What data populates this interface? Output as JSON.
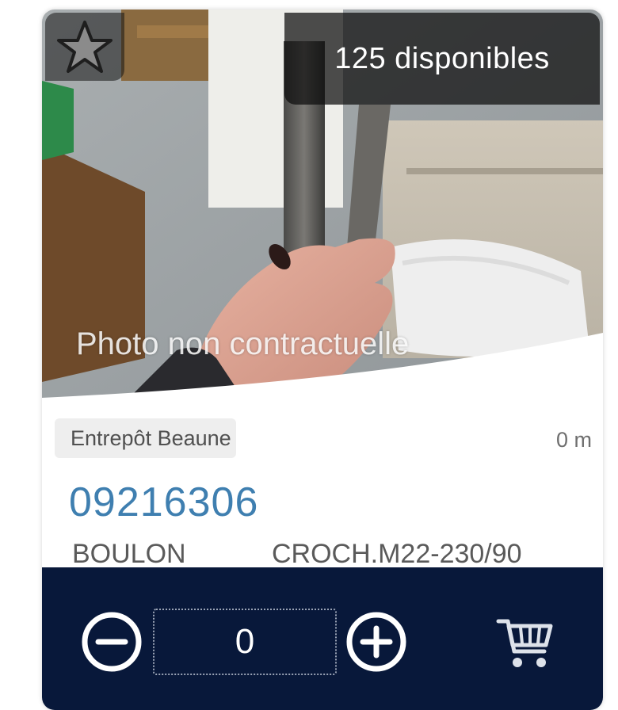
{
  "product_card": {
    "stock_badge": "125 disponibles",
    "photo_disclaimer": "Photo non contractuelle",
    "location": "Entrepôt Beaune",
    "distance": "0 m",
    "reference": "09216306",
    "description": {
      "part1": "BOULON",
      "part2": "CROCH.M22-230/90"
    },
    "quantity": "0",
    "icons": {
      "favorite": "star-icon",
      "decrease": "minus-circle-icon",
      "increase": "plus-circle-icon",
      "add_to_cart": "cart-icon"
    }
  },
  "colors": {
    "reference_link": "#3f7fb0",
    "action_bar": "#08183a",
    "location_tag_bg": "#eeeeee"
  }
}
